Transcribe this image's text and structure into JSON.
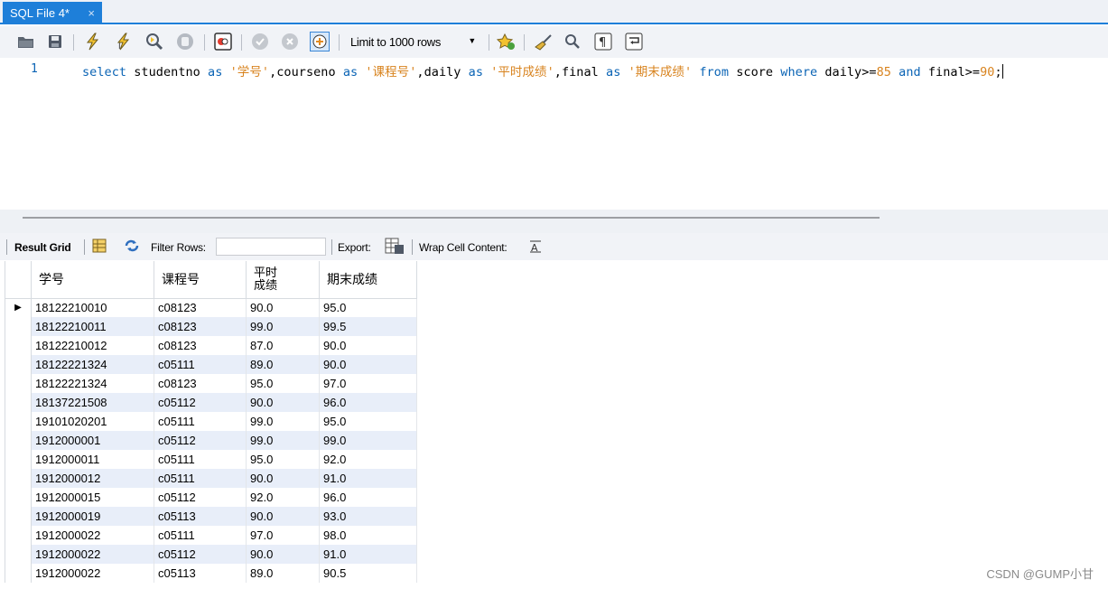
{
  "tab": {
    "title": "SQL File 4*",
    "close": "×"
  },
  "toolbar": {
    "limit_label": "Limit to 1000 rows",
    "icons": [
      "open-folder",
      "save",
      "execute",
      "execute-current",
      "explain",
      "stop",
      "toggle-results",
      "commit",
      "rollback",
      "autocommit",
      "limit-select",
      "beautify",
      "find",
      "invisible-chars",
      "wrap-lines"
    ]
  },
  "editor": {
    "line_number": "1",
    "tokens": [
      {
        "t": "select",
        "c": "kw"
      },
      {
        "t": " studentno ",
        "c": ""
      },
      {
        "t": "as",
        "c": "kw"
      },
      {
        "t": " ",
        "c": ""
      },
      {
        "t": "'学号'",
        "c": "str"
      },
      {
        "t": ",courseno ",
        "c": ""
      },
      {
        "t": "as",
        "c": "kw"
      },
      {
        "t": " ",
        "c": ""
      },
      {
        "t": "'课程号'",
        "c": "str"
      },
      {
        "t": ",daily ",
        "c": ""
      },
      {
        "t": "as",
        "c": "kw"
      },
      {
        "t": " ",
        "c": ""
      },
      {
        "t": "'平时成绩'",
        "c": "str"
      },
      {
        "t": ",final ",
        "c": ""
      },
      {
        "t": "as",
        "c": "kw"
      },
      {
        "t": " ",
        "c": ""
      },
      {
        "t": "'期末成绩'",
        "c": "str"
      },
      {
        "t": " ",
        "c": ""
      },
      {
        "t": "from",
        "c": "kw"
      },
      {
        "t": " score ",
        "c": ""
      },
      {
        "t": "where",
        "c": "kw"
      },
      {
        "t": " daily>=",
        "c": ""
      },
      {
        "t": "85",
        "c": "num"
      },
      {
        "t": " ",
        "c": ""
      },
      {
        "t": "and",
        "c": "kw"
      },
      {
        "t": " final>=",
        "c": ""
      },
      {
        "t": "90",
        "c": "num"
      },
      {
        "t": ";",
        "c": ""
      }
    ]
  },
  "result_toolbar": {
    "result_grid": "Result Grid",
    "filter_rows": "Filter Rows:",
    "filter_value": "",
    "export": "Export:",
    "wrap": "Wrap Cell Content:"
  },
  "grid": {
    "columns": [
      "学号",
      "课程号",
      "平时\n成绩",
      "期末成绩"
    ],
    "rows": [
      [
        "18122210010",
        "c08123",
        "90.0",
        "95.0"
      ],
      [
        "18122210011",
        "c08123",
        "99.0",
        "99.5"
      ],
      [
        "18122210012",
        "c08123",
        "87.0",
        "90.0"
      ],
      [
        "18122221324",
        "c05111",
        "89.0",
        "90.0"
      ],
      [
        "18122221324",
        "c08123",
        "95.0",
        "97.0"
      ],
      [
        "18137221508",
        "c05112",
        "90.0",
        "96.0"
      ],
      [
        "19101020201",
        "c05111",
        "99.0",
        "95.0"
      ],
      [
        "1912000001",
        "c05112",
        "99.0",
        "99.0"
      ],
      [
        "1912000011",
        "c05111",
        "95.0",
        "92.0"
      ],
      [
        "1912000012",
        "c05111",
        "90.0",
        "91.0"
      ],
      [
        "1912000015",
        "c05112",
        "92.0",
        "96.0"
      ],
      [
        "1912000019",
        "c05113",
        "90.0",
        "93.0"
      ],
      [
        "1912000022",
        "c05111",
        "97.0",
        "98.0"
      ],
      [
        "1912000022",
        "c05112",
        "90.0",
        "91.0"
      ],
      [
        "1912000022",
        "c05113",
        "89.0",
        "90.5"
      ]
    ]
  },
  "watermark": "CSDN @GUMP小甘"
}
